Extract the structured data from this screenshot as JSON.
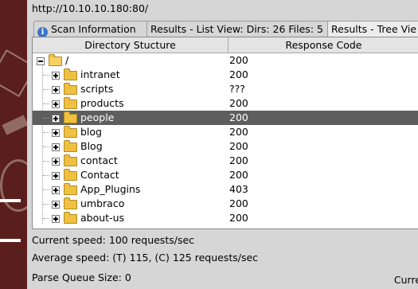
{
  "url": "http://10.10.10.180:80/",
  "tabs": [
    {
      "label": "Scan Information",
      "icon": "info-icon"
    },
    {
      "label": "Results - List View: Dirs: 26 Files: 5"
    },
    {
      "label": "Results - Tree Vie"
    }
  ],
  "table": {
    "col_dir": "Directory Stucture",
    "col_code": "Response Code",
    "root": {
      "name": "/",
      "code": "200"
    },
    "rows": [
      {
        "name": "intranet",
        "code": "200"
      },
      {
        "name": "scripts",
        "code": "???"
      },
      {
        "name": "products",
        "code": "200"
      },
      {
        "name": "people",
        "code": "200",
        "selected": true
      },
      {
        "name": "blog",
        "code": "200"
      },
      {
        "name": "Blog",
        "code": "200"
      },
      {
        "name": "contact",
        "code": "200"
      },
      {
        "name": "Contact",
        "code": "200"
      },
      {
        "name": "App_Plugins",
        "code": "403"
      },
      {
        "name": "umbraco",
        "code": "200"
      },
      {
        "name": "about-us",
        "code": "200"
      }
    ]
  },
  "stats": {
    "current_speed": "Current speed: 100 requests/sec",
    "average_speed": "Average speed: (T) 115, (C) 125 requests/sec",
    "parse_queue": "Parse Queue Size: 0",
    "current_label": "Curre"
  },
  "colors": {
    "selection": "#5e5e5e",
    "folder": "#f0c040",
    "background_left": "#5a1f1c"
  }
}
